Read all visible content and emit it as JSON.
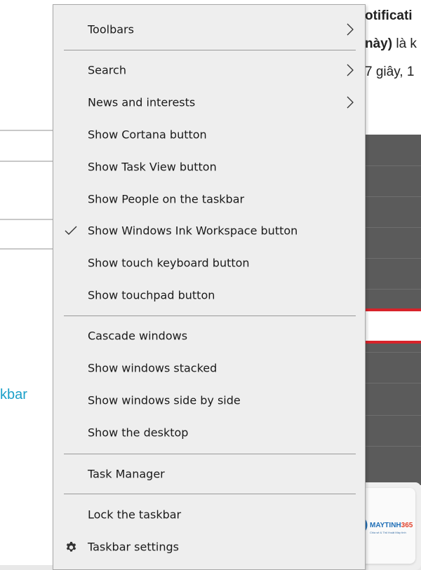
{
  "background": {
    "right_lines": [
      {
        "bold": "otificati",
        "rest": ""
      },
      {
        "bold": "này)",
        "rest": " là k"
      },
      {
        "bold": "",
        "rest": "7 giây, 1"
      }
    ],
    "left_link": "kbar",
    "logo": {
      "brand": "MAYTINH",
      "number": "365",
      "tagline": "Chia sẻ & Thủ thuật Máy tính"
    }
  },
  "menu": {
    "items": {
      "toolbars": {
        "label": "Toolbars",
        "submenu": true
      },
      "search": {
        "label": "Search",
        "submenu": true
      },
      "news": {
        "label": "News and interests",
        "submenu": true
      },
      "cortana": {
        "label": "Show Cortana button"
      },
      "taskview": {
        "label": "Show Task View button"
      },
      "people": {
        "label": "Show People on the taskbar"
      },
      "ink": {
        "label": "Show Windows Ink Workspace button",
        "checked": true
      },
      "touch_keyboard": {
        "label": "Show touch keyboard button"
      },
      "touchpad": {
        "label": "Show touchpad button"
      },
      "cascade": {
        "label": "Cascade windows"
      },
      "stacked": {
        "label": "Show windows stacked"
      },
      "side_by_side": {
        "label": "Show windows side by side"
      },
      "desktop": {
        "label": "Show the desktop"
      },
      "task_manager": {
        "label": "Task Manager"
      },
      "lock": {
        "label": "Lock the taskbar"
      },
      "settings": {
        "label": "Taskbar settings",
        "icon": "gear-icon"
      }
    }
  },
  "colors": {
    "menu_bg": "#eeeeee",
    "highlight_red": "#d8232a",
    "link": "#1a9fc8"
  }
}
